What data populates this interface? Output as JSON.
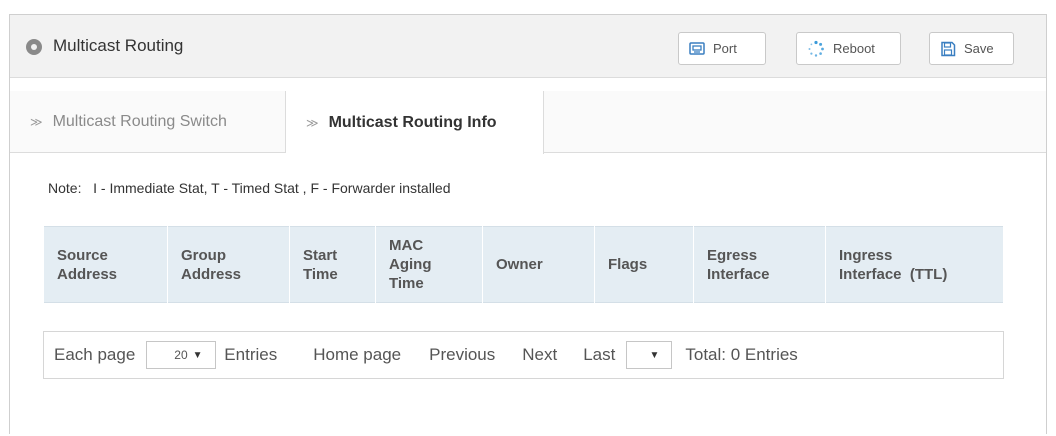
{
  "header": {
    "title": "Multicast Routing",
    "buttons": {
      "port": "Port",
      "reboot": "Reboot",
      "save": "Save"
    }
  },
  "tabs": [
    {
      "label": "Multicast Routing Switch",
      "active": false
    },
    {
      "label": "Multicast Routing Info",
      "active": true
    }
  ],
  "note": "Note:   I - Immediate Stat, T - Timed Stat , F - Forwarder installed",
  "table": {
    "columns": [
      {
        "line1": "Source",
        "line2": "Address",
        "line3": ""
      },
      {
        "line1": "Group",
        "line2": "Address",
        "line3": ""
      },
      {
        "line1": "Start",
        "line2": "Time",
        "line3": ""
      },
      {
        "line1": "MAC",
        "line2": "Aging",
        "line3": "Time"
      },
      {
        "line1": "Owner",
        "line2": "",
        "line3": ""
      },
      {
        "line1": "Flags",
        "line2": "",
        "line3": ""
      },
      {
        "line1": "Egress",
        "line2": "Interface",
        "line3": ""
      },
      {
        "line1": "Ingress",
        "line2": "Interface  (TTL)",
        "line3": ""
      }
    ],
    "rows": []
  },
  "pager": {
    "each_page": "Each page",
    "page_size": "20",
    "entries": "Entries",
    "home": "Home page",
    "previous": "Previous",
    "next": "Next",
    "last": "Last",
    "page_value": "",
    "total": "Total: 0 Entries"
  },
  "colors": {
    "header_bg": "#f2f2f2",
    "table_header_bg": "#e4edf3",
    "icon_gray": "#8a8a8a",
    "reboot_icon": "#3a9ad9"
  }
}
